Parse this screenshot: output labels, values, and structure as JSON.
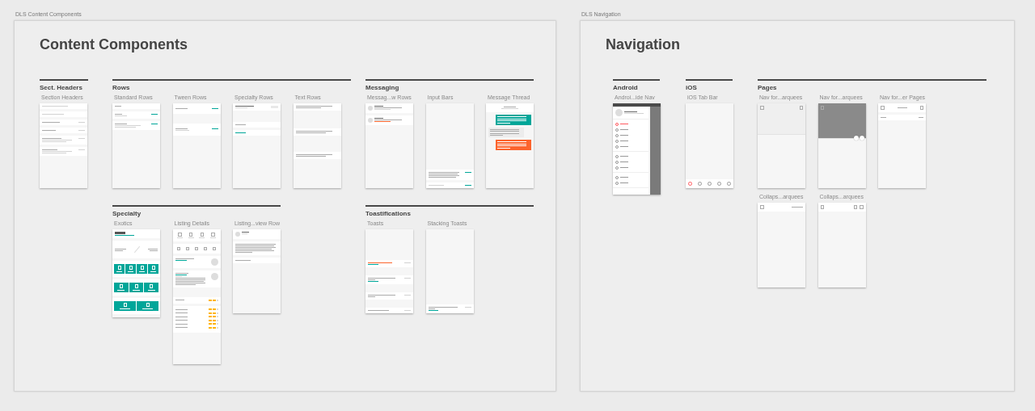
{
  "artboards": [
    {
      "name": "DLS Content Components",
      "title": "Content Components",
      "groups": [
        {
          "title": "Sect. Headers",
          "frames": [
            {
              "label": "Section Headers",
              "kind": "headers"
            }
          ]
        },
        {
          "title": "Rows",
          "frames": [
            {
              "label": "Standard Rows",
              "kind": "standard"
            },
            {
              "label": "Tween Rows",
              "kind": "tween"
            },
            {
              "label": "Specialty Rows",
              "kind": "specialty"
            },
            {
              "label": "Text Rows",
              "kind": "text"
            }
          ]
        },
        {
          "title": "Messaging",
          "frames": [
            {
              "label": "Messag...w Rows",
              "kind": "messages"
            },
            {
              "label": "Input Bars",
              "kind": "input"
            },
            {
              "label": "Message Thread",
              "kind": "thread",
              "bubbles": [
                {
                  "kind": "outgoing",
                  "color": "#00a699"
                },
                {
                  "kind": "incoming",
                  "color": "#ececec"
                },
                {
                  "kind": "outgoing",
                  "color": "#fc642d"
                }
              ]
            }
          ]
        },
        {
          "title": "Specialty",
          "frames": [
            {
              "label": "Exotics",
              "kind": "exotics"
            },
            {
              "label": "Listing Details",
              "kind": "listing"
            },
            {
              "label": "Listing...view Row",
              "kind": "review"
            }
          ]
        },
        {
          "title": "Toastifications",
          "frames": [
            {
              "label": "Toasts",
              "kind": "toasts"
            },
            {
              "label": "Stacking Toasts",
              "kind": "stacking"
            }
          ]
        }
      ]
    },
    {
      "name": "DLS Navigation",
      "title": "Navigation",
      "groups": [
        {
          "title": "Android",
          "frames": [
            {
              "label": "Androi...ide Nav",
              "kind": "drawer",
              "sections": [
                [
                  {
                    "selected": true
                  },
                  {
                    "selected": false
                  },
                  {
                    "selected": false
                  },
                  {
                    "selected": false
                  },
                  {
                    "selected": false
                  }
                ],
                [
                  {
                    "selected": false
                  },
                  {
                    "selected": false
                  },
                  {
                    "selected": false
                  }
                ],
                [
                  {
                    "selected": false
                  },
                  {
                    "selected": false
                  }
                ]
              ]
            }
          ]
        },
        {
          "title": "iOS",
          "frames": [
            {
              "label": "iOS Tab Bar",
              "kind": "tabbar",
              "tabs": [
                {
                  "selected": true
                },
                {
                  "selected": false
                },
                {
                  "selected": false
                },
                {
                  "selected": false
                },
                {
                  "selected": false
                }
              ]
            }
          ]
        },
        {
          "title": "Pages",
          "frames": [
            {
              "label": "Nav for...arquees",
              "kind": "marquee",
              "image": false
            },
            {
              "label": "Nav for...arquees",
              "kind": "marquee",
              "image": true
            },
            {
              "label": "Nav for...er Pages",
              "kind": "pagenav"
            },
            {
              "label": "Collaps...arquees",
              "kind": "collapsed",
              "title": true
            },
            {
              "label": "Collaps...arquees",
              "kind": "collapsed",
              "title": false
            }
          ]
        }
      ]
    }
  ]
}
